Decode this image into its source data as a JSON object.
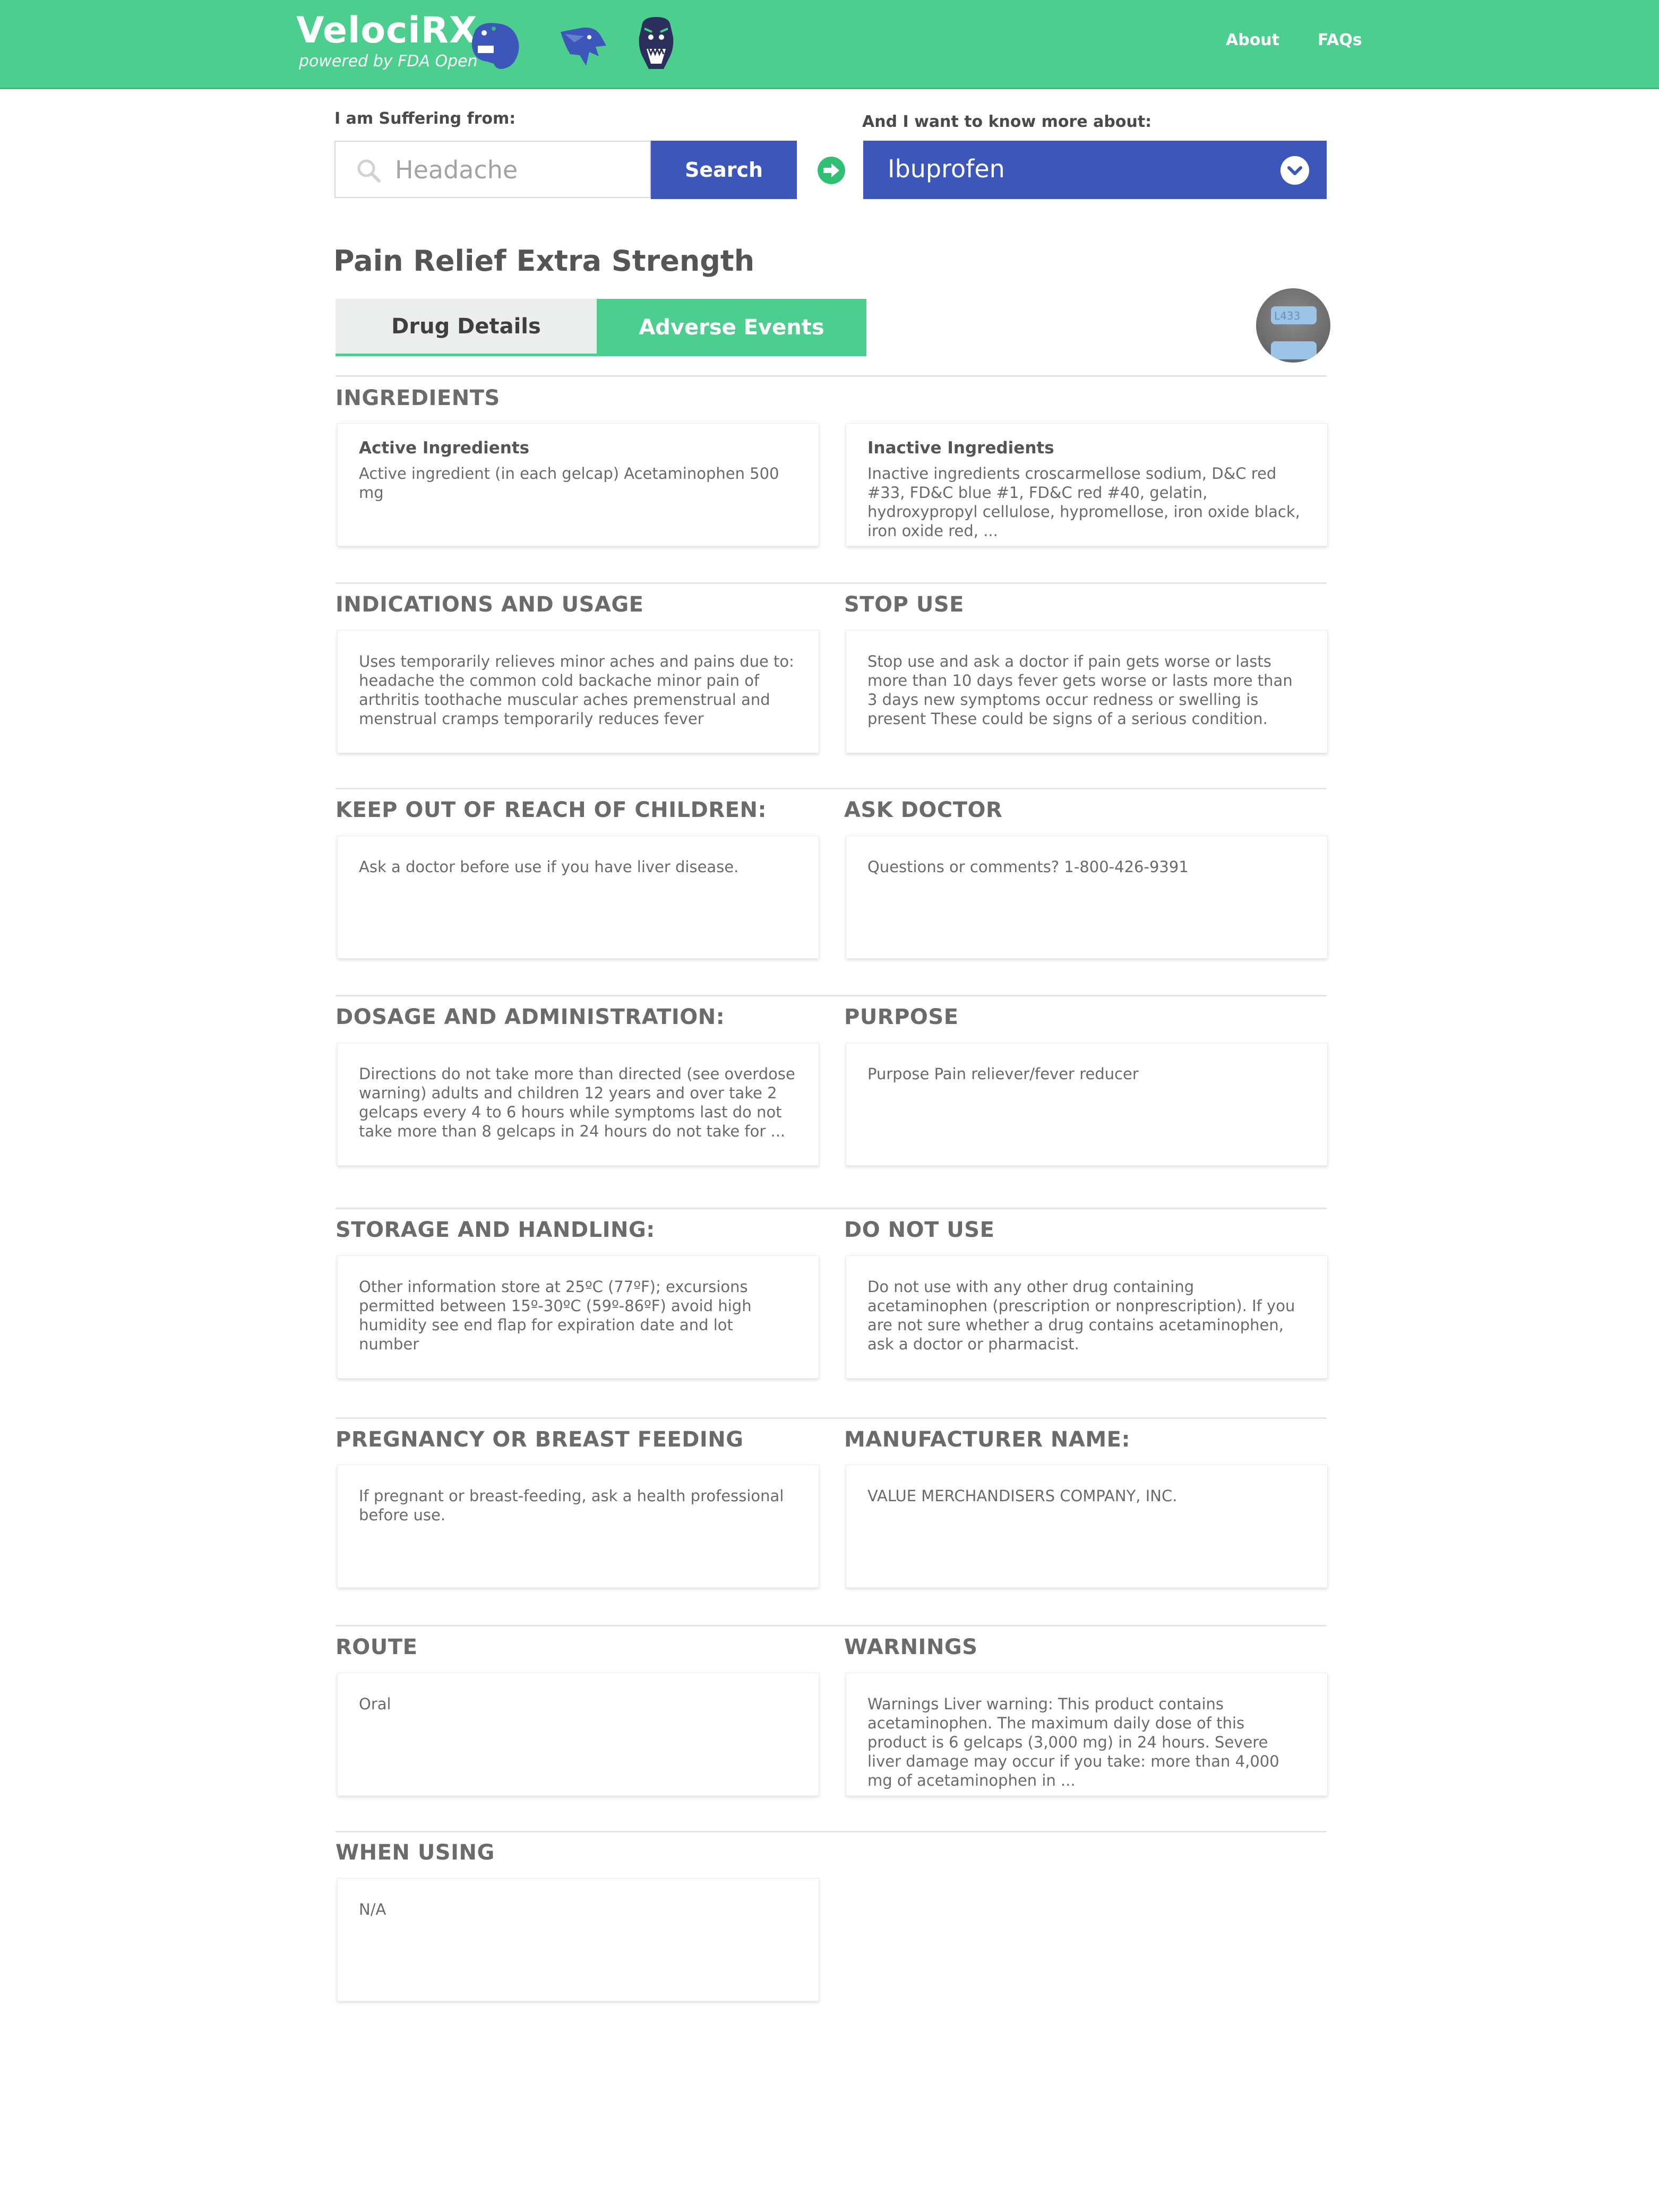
{
  "header": {
    "logo": "VelociRX",
    "tagline": "powered by FDA Open",
    "nav": [
      "About",
      "FAQs"
    ]
  },
  "search": {
    "suffering_label": "I am Suffering from:",
    "placeholder": "Headache",
    "button": "Search",
    "know_more_label": "And I want to know more about:",
    "selected_drug": "Ibuprofen"
  },
  "drug": {
    "title": "Pain Relief Extra Strength",
    "tabs": [
      "Drug Details",
      "Adverse Events"
    ],
    "pill_imprint": "L433"
  },
  "sections": {
    "ingredients": {
      "heading": "INGREDIENTS",
      "active_title": "Active Ingredients",
      "active_text": "Active ingredient (in each gelcap) Acetaminophen 500 mg",
      "inactive_title": "Inactive Ingredients",
      "inactive_text": "Inactive ingredients croscarmellose sodium, D&C red #33, FD&C blue #1, FD&C red #40, gelatin, hydroxypropyl cellulose, hypromellose, iron oxide black, iron oxide red, ..."
    },
    "indications": {
      "heading": "INDICATIONS AND USAGE",
      "text": "Uses temporarily relieves minor aches and pains due to: headache the common cold backache minor pain of arthritis toothache muscular aches premenstrual and menstrual cramps temporarily reduces fever"
    },
    "stop_use": {
      "heading": "STOP USE",
      "text": "Stop use and ask a doctor if pain gets worse or lasts more than 10 days fever gets worse or lasts more than 3 days new symptoms occur redness or swelling is present These could be signs of a serious condition."
    },
    "keep_out": {
      "heading": "KEEP OUT OF REACH OF CHILDREN:",
      "text": "Ask a doctor before use if you have liver disease."
    },
    "ask_doctor": {
      "heading": "ASK DOCTOR",
      "text": "Questions or comments? 1-800-426-9391"
    },
    "dosage": {
      "heading": "DOSAGE AND ADMINISTRATION:",
      "text": "Directions do not take more than directed (see overdose warning) adults and children 12 years and over take 2 gelcaps every 4 to 6 hours while symptoms last do not take more than 8 gelcaps in 24 hours do not take for ..."
    },
    "purpose": {
      "heading": "PURPOSE",
      "text": "Purpose Pain reliever/fever reducer"
    },
    "storage": {
      "heading": "STORAGE AND HANDLING:",
      "text": "Other information store at 25ºC (77ºF); excursions permitted between 15º-30ºC (59º-86ºF) avoid high humidity see end flap for expiration date and lot number"
    },
    "do_not_use": {
      "heading": "DO NOT USE",
      "text": "Do not use with any other drug containing acetaminophen (prescription or nonprescription). If you are not sure whether a drug contains acetaminophen, ask a doctor or pharmacist."
    },
    "pregnancy": {
      "heading": "PREGNANCY OR BREAST FEEDING",
      "text": "If pregnant or breast-feeding, ask a health professional before use."
    },
    "manufacturer": {
      "heading": "MANUFACTURER NAME:",
      "text": "VALUE MERCHANDISERS COMPANY, INC."
    },
    "route": {
      "heading": "ROUTE",
      "text": "Oral"
    },
    "warnings": {
      "heading": "WARNINGS",
      "text": "Warnings Liver warning: This product contains acetaminophen. The maximum daily dose of this product is 6 gelcaps (3,000 mg) in 24 hours. Severe liver damage may occur if you take: more than 4,000 mg of acetaminophen in ..."
    },
    "when_using": {
      "heading": "WHEN USING",
      "text": "N/A"
    }
  },
  "colors": {
    "header_green": "#4ccf8e",
    "brand_blue": "#3d56b9",
    "arrow_green": "#2fbf75"
  }
}
